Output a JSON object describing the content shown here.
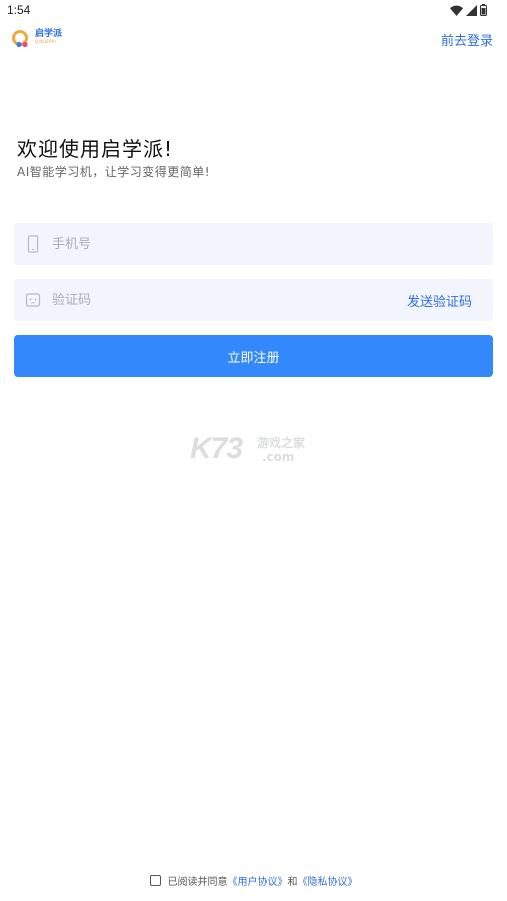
{
  "status_bar": {
    "time": "1:54"
  },
  "header": {
    "logo_text": "启学派",
    "logo_subtext": "QIXUEPAI",
    "goto_login": "前去登录"
  },
  "welcome": {
    "title": "欢迎使用启学派!",
    "subtitle": "AI智能学习机，让学习变得更简单!"
  },
  "form": {
    "phone_placeholder": "手机号",
    "code_placeholder": "验证码",
    "send_code": "发送验证码",
    "register_button": "立即注册"
  },
  "watermark": {
    "brand": "K73",
    "cn": "游戏之家",
    "domain": ".com"
  },
  "agreement": {
    "prefix": "已阅读并同意",
    "user_agreement": "《用户协议》",
    "and": "和",
    "privacy_agreement": "《隐私协议》"
  },
  "colors": {
    "accent": "#3388fc",
    "link": "#2f6fe0",
    "field_bg": "#f2f5fb"
  }
}
